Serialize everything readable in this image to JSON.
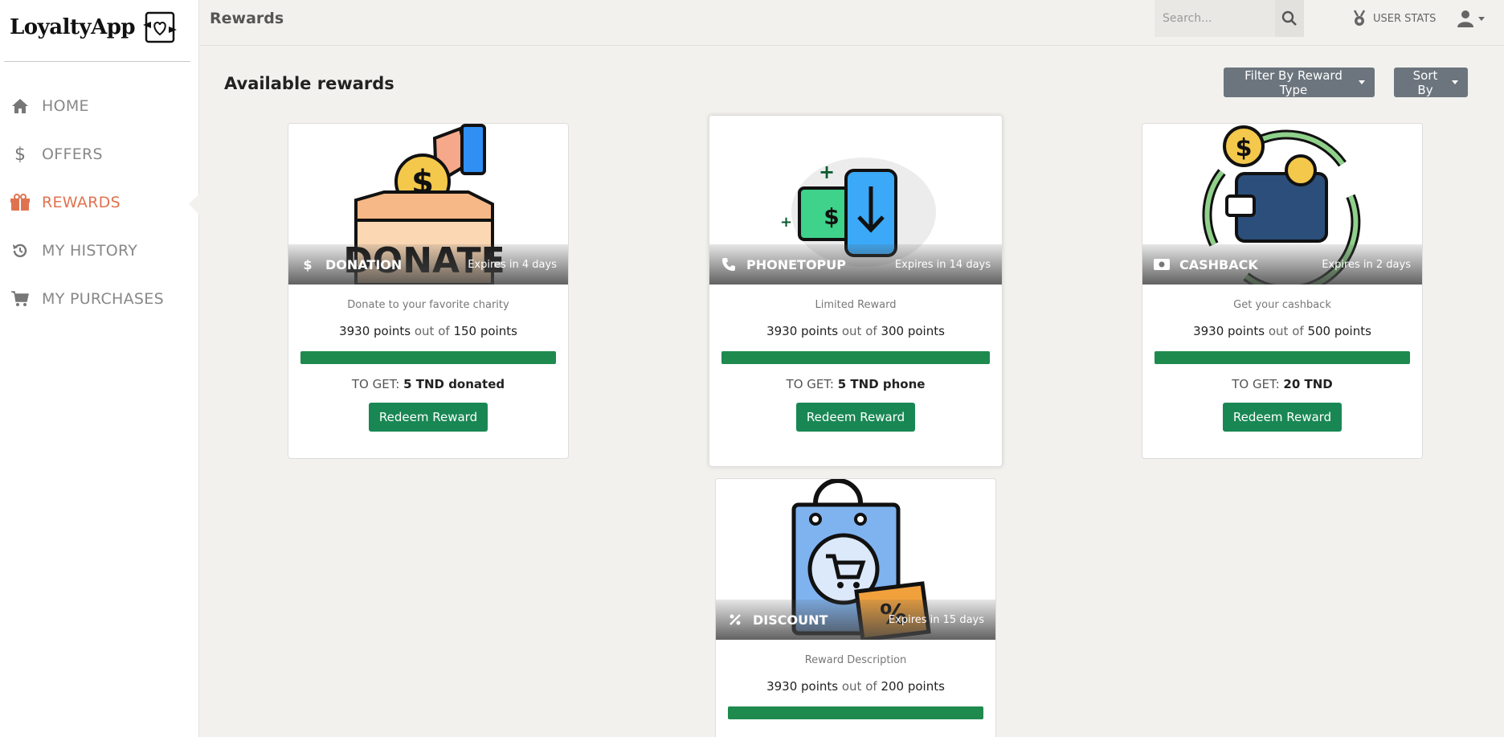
{
  "app": {
    "name": "LoyaltyApp"
  },
  "sidebar": {
    "items": [
      {
        "label": "HOME",
        "icon": "home-icon"
      },
      {
        "label": "OFFERS",
        "icon": "dollar-icon"
      },
      {
        "label": "REWARDS",
        "icon": "gift-icon",
        "active": true
      },
      {
        "label": "MY HISTORY",
        "icon": "history-icon"
      },
      {
        "label": "MY PURCHASES",
        "icon": "cart-icon"
      }
    ]
  },
  "header": {
    "title": "Rewards",
    "search_placeholder": "Search...",
    "user_stats_label": "USER STATS"
  },
  "main": {
    "section_title": "Available rewards",
    "filter_label": "Filter By Reward Type",
    "sort_label": "Sort By",
    "accent_color": "#198754",
    "active_color": "#e0734f"
  },
  "rewards": [
    {
      "type": "DONATION",
      "type_icon": "dollar-icon",
      "expires": "Expires in 4 days",
      "description": "Donate to your favorite charity",
      "current_points": "3930 points",
      "out_of": "out of",
      "required_points": "150 points",
      "progress": 1.0,
      "to_get_label": "TO GET:",
      "to_get_value": "5 TND donated",
      "button": "Redeem Reward"
    },
    {
      "type": "PHONETOPUP",
      "type_icon": "phone-icon",
      "expires": "Expires in 14 days",
      "description": "Limited Reward",
      "current_points": "3930 points",
      "out_of": "out of",
      "required_points": "300 points",
      "progress": 1.0,
      "to_get_label": "TO GET:",
      "to_get_value": "5 TND phone",
      "button": "Redeem Reward"
    },
    {
      "type": "CASHBACK",
      "type_icon": "money-icon",
      "expires": "Expires in 2 days",
      "description": "Get your cashback",
      "current_points": "3930 points",
      "out_of": "out of",
      "required_points": "500 points",
      "progress": 1.0,
      "to_get_label": "TO GET:",
      "to_get_value": "20 TND",
      "button": "Redeem Reward"
    },
    {
      "type": "DISCOUNT",
      "type_icon": "percent-icon",
      "expires": "Expires in 15 days",
      "description": "Reward Description",
      "current_points": "3930 points",
      "out_of": "out of",
      "required_points": "200 points",
      "progress": 1.0
    }
  ]
}
